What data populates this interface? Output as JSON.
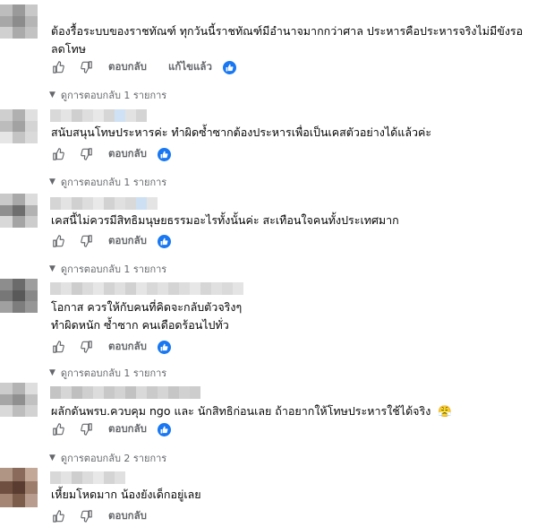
{
  "comments": [
    {
      "text_lines": [
        "ต้องรื้อระบบของราชทัณฑ์ ทุกวันนี้ราชทัณฑ์มีอำนาจมากกว่าศาล ประหารคือประหารจริงไม่มีขังรอ",
        "ลดโทษ"
      ],
      "reply_label": "ตอบกลับ",
      "edited_label": "แก้ไขแล้ว",
      "replies_label": "ดูการตอบกลับ 1 รายการ"
    },
    {
      "text_lines": [
        "สนับสนุนโทษประหารค่ะ ทำผิดซ้ำซากต้องประหารเพื่อเป็นเคสตัวอย่างได้แล้วค่ะ"
      ],
      "reply_label": "ตอบกลับ",
      "replies_label": "ดูการตอบกลับ 1 รายการ"
    },
    {
      "text_lines": [
        "เคสนี้ไม่ควรมีสิทธิมนุษยธรรมอะไรทั้งนั้นค่ะ สะเทือนใจคนทั้งประเทศมาก"
      ],
      "reply_label": "ตอบกลับ",
      "replies_label": "ดูการตอบกลับ 1 รายการ"
    },
    {
      "text_lines": [
        "โอกาส ควรให้กับคนที่คิดจะกลับตัวจริงๆ",
        "ทำผิดหนัก ซ้ำซาก คนเดือดร้อนไปทั่ว"
      ],
      "reply_label": "ตอบกลับ",
      "replies_label": "ดูการตอบกลับ 1 รายการ"
    },
    {
      "text_lines": [
        "ผลักดันพรบ.ควบคุม ngo และ นักสิทธิก่อนเลย ถ้าอยากให้โทษประหารใช้ได้จริง"
      ],
      "emoji": "😤",
      "reply_label": "ตอบกลับ",
      "replies_label": "ดูการตอบกลับ 2 รายการ"
    },
    {
      "text_lines": [
        "เหี้ยมโหดมาก น้องยังเด็กอยู่เลย"
      ],
      "reply_label": "ตอบกลับ"
    }
  ],
  "colors": {
    "text": "#050505",
    "meta": "#65676b",
    "like_badge": "#1877f2"
  },
  "icons": {
    "like": "thumbs-up-icon",
    "dislike": "thumbs-down-icon",
    "reaction": "like-reaction-icon",
    "expand": "reply-arrow-icon"
  }
}
